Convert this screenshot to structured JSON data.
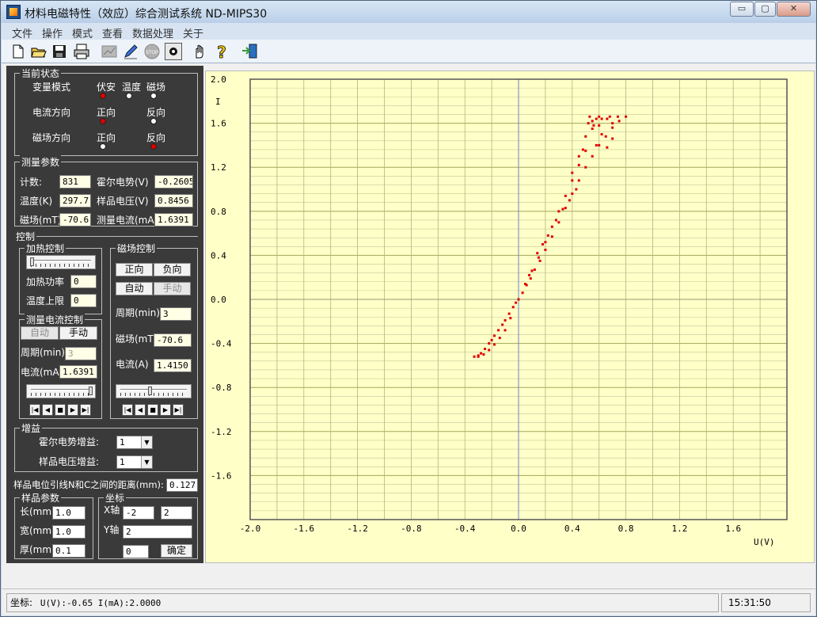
{
  "app": {
    "title": "材料电磁特性（效应）综合测试系统 ND-MIPS30"
  },
  "window_controls": {
    "minimize": "▭",
    "restore": "▢",
    "close": "✕"
  },
  "menu": [
    "文件",
    "操作",
    "模式",
    "查看",
    "数据处理",
    "关于"
  ],
  "toolbar": {
    "icons": [
      "new-file-icon",
      "open-folder-icon",
      "save-disk-icon",
      "print-icon",
      "chart-icon",
      "pen-icon",
      "stop-icon",
      "record-icon",
      "hand-icon",
      "help-icon",
      "exit-icon"
    ],
    "stop_label": "STOP"
  },
  "status_group": {
    "title": "当前状态",
    "mode_label": "变量模式",
    "mode_options": [
      {
        "label": "伏安",
        "on": true
      },
      {
        "label": "温度",
        "on": false
      },
      {
        "label": "磁场",
        "on": false
      }
    ],
    "current_dir_label": "电流方向",
    "current_options": [
      {
        "label": "正向",
        "on": true
      },
      {
        "label": "反向",
        "on": false
      }
    ],
    "field_dir_label": "磁场方向",
    "field_options": [
      {
        "label": "正向",
        "on": false
      },
      {
        "label": "反向",
        "on": true
      }
    ]
  },
  "measure": {
    "title": "测量参数",
    "count_label": "计数:",
    "count": "831",
    "hall_label": "霍尔电势(V)",
    "hall": "-0.2605",
    "temp_label": "温度(K)",
    "temp": "297.7",
    "sample_v_label": "样品电压(V)",
    "sample_v": "0.8456",
    "field_label": "磁场(mT)",
    "field": "-70.6",
    "current_label": "测量电流(mA)",
    "current": "1.6391"
  },
  "control": {
    "title": "控制",
    "heat": {
      "title": "加热控制",
      "power_label": "加热功率",
      "power": "0",
      "limit_label": "温度上限",
      "limit": "0"
    },
    "meas_current": {
      "title": "测量电流控制",
      "auto": "自动",
      "manual": "手动",
      "period_label": "周期(min)",
      "period": "3",
      "current_label": "电流(mA)",
      "current": "1.6391",
      "slider_fraction": 1.0
    },
    "field_ctrl": {
      "title": "磁场控制",
      "forward": "正向",
      "reverse": "负向",
      "auto": "自动",
      "manual": "手动",
      "period_label": "周期(min)",
      "period": "3",
      "field_label": "磁场(mT)",
      "field": "-70.6",
      "current_label": "电流(A)",
      "current": "1.4150",
      "slider_fraction": 0.45
    },
    "nav_buttons": [
      "|◀",
      "◀",
      "■",
      "▶",
      "▶|"
    ]
  },
  "gain": {
    "title": "增益",
    "hall_label": "霍尔电势增益:",
    "hall": "1",
    "sample_label": "样品电压增益:",
    "sample": "1"
  },
  "distance": {
    "label": "样品电位引线N和C之间的距离(mm):",
    "value": "0.127"
  },
  "sample": {
    "title": "样品参数",
    "length_label": "长(mm)",
    "length": "1.0",
    "width_label": "宽(mm)",
    "width": "1.0",
    "thick_label": "厚(mm)",
    "thick": "0.1"
  },
  "coords": {
    "title": "坐标",
    "x_label": "X轴",
    "x_min": "-2",
    "x_max": "2",
    "y_label": "Y轴",
    "y_max": "2",
    "y_min": "0",
    "ok": "确定"
  },
  "status": {
    "coord_label": "坐标:",
    "coord_value": "U(V):-0.65   I(mA):2.0000",
    "time": "15:31:50"
  },
  "chart_data": {
    "type": "scatter",
    "title": "",
    "xlabel": "U(V)",
    "ylabel": "I",
    "xlim": [
      -2.0,
      2.0
    ],
    "ylim": [
      -2.0,
      2.0
    ],
    "x_ticks": [
      "-2.0",
      "-1.6",
      "-1.2",
      "-0.8",
      "-0.4",
      "0.0",
      "0.4",
      "0.8",
      "1.2",
      "1.6"
    ],
    "y_ticks": [
      "2.0",
      "1.6",
      "1.2",
      "0.8",
      "0.4",
      "0.0",
      "-0.4",
      "-0.8",
      "-1.2",
      "-1.6"
    ],
    "grid": true,
    "series": [
      {
        "color": "#e00000",
        "points": [
          [
            -0.33,
            -0.52
          ],
          [
            -0.3,
            -0.51
          ],
          [
            -0.28,
            -0.49
          ],
          [
            -0.25,
            -0.45
          ],
          [
            -0.22,
            -0.4
          ],
          [
            -0.2,
            -0.37
          ],
          [
            -0.18,
            -0.33
          ],
          [
            -0.15,
            -0.28
          ],
          [
            -0.12,
            -0.23
          ],
          [
            -0.1,
            -0.19
          ],
          [
            -0.07,
            -0.13
          ],
          [
            -0.04,
            -0.07
          ],
          [
            -0.02,
            -0.03
          ],
          [
            0.0,
            0.0
          ],
          [
            0.03,
            0.06
          ],
          [
            0.06,
            0.13
          ],
          [
            0.09,
            0.19
          ],
          [
            0.12,
            0.27
          ],
          [
            0.16,
            0.35
          ],
          [
            0.2,
            0.45
          ],
          [
            0.25,
            0.57
          ],
          [
            0.3,
            0.7
          ],
          [
            0.35,
            0.83
          ],
          [
            0.4,
            0.96
          ],
          [
            0.45,
            1.08
          ],
          [
            0.5,
            1.2
          ],
          [
            0.55,
            1.3
          ],
          [
            0.6,
            1.4
          ],
          [
            0.65,
            1.48
          ],
          [
            0.7,
            1.56
          ],
          [
            0.75,
            1.62
          ],
          [
            0.8,
            1.66
          ],
          [
            -0.3,
            -0.52
          ],
          [
            -0.26,
            -0.5
          ],
          [
            -0.22,
            -0.46
          ],
          [
            -0.18,
            -0.41
          ],
          [
            -0.14,
            -0.35
          ],
          [
            -0.1,
            -0.28
          ],
          [
            -0.06,
            -0.17
          ],
          [
            0.05,
            0.14
          ],
          [
            0.1,
            0.26
          ],
          [
            0.15,
            0.38
          ],
          [
            0.2,
            0.52
          ],
          [
            0.25,
            0.66
          ],
          [
            0.3,
            0.8
          ],
          [
            0.35,
            0.94
          ],
          [
            0.4,
            1.08
          ],
          [
            0.45,
            1.22
          ],
          [
            0.48,
            1.36
          ],
          [
            0.5,
            1.48
          ],
          [
            0.52,
            1.6
          ],
          [
            0.53,
            1.66
          ],
          [
            0.6,
            1.66
          ],
          [
            0.68,
            1.66
          ],
          [
            0.74,
            1.66
          ],
          [
            0.55,
            1.55
          ],
          [
            0.58,
            1.4
          ],
          [
            0.62,
            1.5
          ],
          [
            0.66,
            1.38
          ],
          [
            0.7,
            1.46
          ],
          [
            0.45,
            1.3
          ],
          [
            0.4,
            1.15
          ],
          [
            0.55,
            1.62
          ],
          [
            0.58,
            1.64
          ],
          [
            0.62,
            1.64
          ],
          [
            0.66,
            1.64
          ],
          [
            0.7,
            1.6
          ],
          [
            0.6,
            1.58
          ],
          [
            0.56,
            1.58
          ],
          [
            0.5,
            1.35
          ],
          [
            0.43,
            1.0
          ],
          [
            0.38,
            0.9
          ],
          [
            0.33,
            0.82
          ],
          [
            0.28,
            0.72
          ],
          [
            0.22,
            0.58
          ],
          [
            0.18,
            0.5
          ],
          [
            0.14,
            0.42
          ],
          [
            0.08,
            0.22
          ]
        ]
      }
    ]
  }
}
